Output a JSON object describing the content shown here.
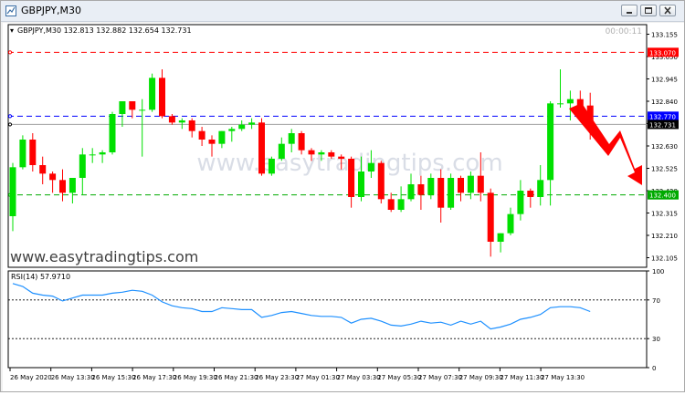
{
  "window": {
    "title": "GBPJPY,M30"
  },
  "header": {
    "symbol_info": "GBPJPY,M30  132.813 132.882 132.654 132.731",
    "timer": "00:00:11"
  },
  "watermark": {
    "center_text": "www.easytradingtips.com",
    "left_text": "www.easytradingtips.com"
  },
  "price_axis": {
    "ticks": [
      "133.155",
      "133.050",
      "132.945",
      "132.840",
      "132.735",
      "132.630",
      "132.525",
      "132.420",
      "132.315",
      "132.210",
      "132.105"
    ]
  },
  "levels": {
    "red": {
      "label": "133.070",
      "color": "#ff0000"
    },
    "blue": {
      "label": "132.770",
      "color": "#0000ff"
    },
    "last": {
      "label": "132.731",
      "color": "#000000"
    },
    "green": {
      "label": "132.400",
      "color": "#00aa00"
    }
  },
  "rsi": {
    "label": "RSI(14) 57.9710",
    "ticks": [
      "100",
      "70",
      "30",
      "0"
    ],
    "color": "#1e90ff"
  },
  "time_axis": {
    "labels": [
      "26 May 2020",
      "26 May 13:30",
      "26 May 15:30",
      "26 May 17:30",
      "26 May 19:30",
      "26 May 21:30",
      "26 May 23:30",
      "27 May 01:30",
      "27 May 03:30",
      "27 May 05:30",
      "27 May 07:30",
      "27 May 09:30",
      "27 May 11:30",
      "27 May 13:30"
    ]
  },
  "colors": {
    "bull": "#00e000",
    "bear": "#ff0000",
    "arrow": "#ff0000"
  },
  "chart_data": {
    "type": "candlestick",
    "title": "GBPJPY,M30",
    "ylim": [
      132.06,
      133.2
    ],
    "x": [
      "26 May 2020",
      "",
      "",
      "",
      "",
      "",
      "",
      "",
      "26 May 13:30",
      "",
      "",
      "",
      "26 May 15:30",
      "",
      "",
      "",
      "26 May 17:30",
      "",
      "",
      "",
      "26 May 19:30",
      "",
      "",
      "",
      "26 May 21:30",
      "",
      "",
      "",
      "26 May 23:30",
      "",
      "",
      "",
      "27 May 01:30",
      "",
      "",
      "",
      "27 May 03:30",
      "",
      "",
      "",
      "27 May 05:30",
      "",
      "",
      "",
      "27 May 07:30",
      "",
      "",
      "",
      "27 May 09:30",
      "",
      "",
      "",
      "27 May 11:30",
      "",
      "",
      "",
      "27 May 13:30",
      "",
      "",
      ""
    ],
    "ohlc": [
      [
        132.3,
        132.55,
        132.23,
        132.53
      ],
      [
        132.53,
        132.68,
        132.52,
        132.66
      ],
      [
        132.66,
        132.69,
        132.51,
        132.54
      ],
      [
        132.54,
        132.58,
        132.45,
        132.5
      ],
      [
        132.5,
        132.51,
        132.41,
        132.47
      ],
      [
        132.47,
        132.52,
        132.37,
        132.41
      ],
      [
        132.41,
        132.48,
        132.36,
        132.48
      ],
      [
        132.48,
        132.62,
        132.4,
        132.59
      ],
      [
        132.59,
        132.62,
        132.55,
        132.59
      ],
      [
        132.59,
        132.61,
        132.55,
        132.6
      ],
      [
        132.6,
        132.79,
        132.59,
        132.78
      ],
      [
        132.78,
        132.84,
        132.72,
        132.84
      ],
      [
        132.84,
        132.84,
        132.76,
        132.8
      ],
      [
        132.8,
        132.85,
        132.58,
        132.8
      ],
      [
        132.8,
        132.97,
        132.79,
        132.95
      ],
      [
        132.95,
        132.99,
        132.76,
        132.77
      ],
      [
        132.77,
        132.78,
        132.73,
        132.74
      ],
      [
        132.74,
        132.76,
        132.71,
        132.75
      ],
      [
        132.75,
        132.76,
        132.67,
        132.7
      ],
      [
        132.7,
        132.72,
        132.63,
        132.66
      ],
      [
        132.66,
        132.68,
        132.58,
        132.64
      ],
      [
        132.64,
        132.7,
        132.62,
        132.7
      ],
      [
        132.7,
        132.72,
        132.65,
        132.71
      ],
      [
        132.71,
        132.75,
        132.7,
        132.73
      ],
      [
        132.73,
        132.76,
        132.71,
        132.74
      ],
      [
        132.74,
        132.76,
        132.49,
        132.5
      ],
      [
        132.5,
        132.58,
        132.49,
        132.57
      ],
      [
        132.57,
        132.67,
        132.56,
        132.64
      ],
      [
        132.64,
        132.71,
        132.6,
        132.69
      ],
      [
        132.69,
        132.7,
        132.59,
        132.61
      ],
      [
        132.61,
        132.62,
        132.56,
        132.59
      ],
      [
        132.59,
        132.61,
        132.56,
        132.6
      ],
      [
        132.6,
        132.61,
        132.57,
        132.58
      ],
      [
        132.58,
        132.59,
        132.52,
        132.57
      ],
      [
        132.57,
        132.58,
        132.34,
        132.39
      ],
      [
        132.39,
        132.58,
        132.37,
        132.51
      ],
      [
        132.51,
        132.61,
        132.48,
        132.55
      ],
      [
        132.55,
        132.56,
        132.36,
        132.38
      ],
      [
        132.38,
        132.41,
        132.32,
        132.33
      ],
      [
        132.33,
        132.44,
        132.32,
        132.38
      ],
      [
        132.38,
        132.5,
        132.37,
        132.45
      ],
      [
        132.45,
        132.49,
        132.33,
        132.4
      ],
      [
        132.4,
        132.5,
        132.38,
        132.48
      ],
      [
        132.48,
        132.52,
        132.27,
        132.34
      ],
      [
        132.34,
        132.5,
        132.33,
        132.48
      ],
      [
        132.48,
        132.49,
        132.37,
        132.41
      ],
      [
        132.41,
        132.51,
        132.38,
        132.49
      ],
      [
        132.49,
        132.6,
        132.37,
        132.41
      ],
      [
        132.41,
        132.43,
        132.11,
        132.18
      ],
      [
        132.18,
        132.22,
        132.13,
        132.22
      ],
      [
        132.22,
        132.34,
        132.21,
        132.31
      ],
      [
        132.31,
        132.47,
        132.28,
        132.42
      ],
      [
        132.42,
        132.43,
        132.34,
        132.39
      ],
      [
        132.39,
        132.54,
        132.35,
        132.47
      ],
      [
        132.47,
        132.84,
        132.35,
        132.83
      ],
      [
        132.83,
        132.99,
        132.81,
        132.83
      ],
      [
        132.83,
        132.89,
        132.75,
        132.85
      ],
      [
        132.85,
        132.89,
        132.76,
        132.82
      ],
      [
        132.82,
        132.88,
        132.66,
        132.73
      ]
    ],
    "rsi_values": [
      87,
      84,
      77,
      75,
      74,
      69,
      72,
      75,
      75,
      75,
      77,
      78,
      80,
      79,
      75,
      68,
      64,
      62,
      61,
      58,
      58,
      62,
      61,
      60,
      60,
      52,
      54,
      57,
      58,
      56,
      54,
      53,
      53,
      52,
      46,
      50,
      51,
      48,
      44,
      43,
      45,
      48,
      46,
      47,
      44,
      48,
      45,
      48,
      40,
      42,
      45,
      50,
      52,
      55,
      62,
      63,
      63,
      62,
      58
    ],
    "rsi_ylim": [
      0,
      100
    ],
    "rsi_levels": [
      70,
      30
    ],
    "levels": [
      133.07,
      132.77,
      132.731,
      132.4
    ],
    "grid": false
  }
}
